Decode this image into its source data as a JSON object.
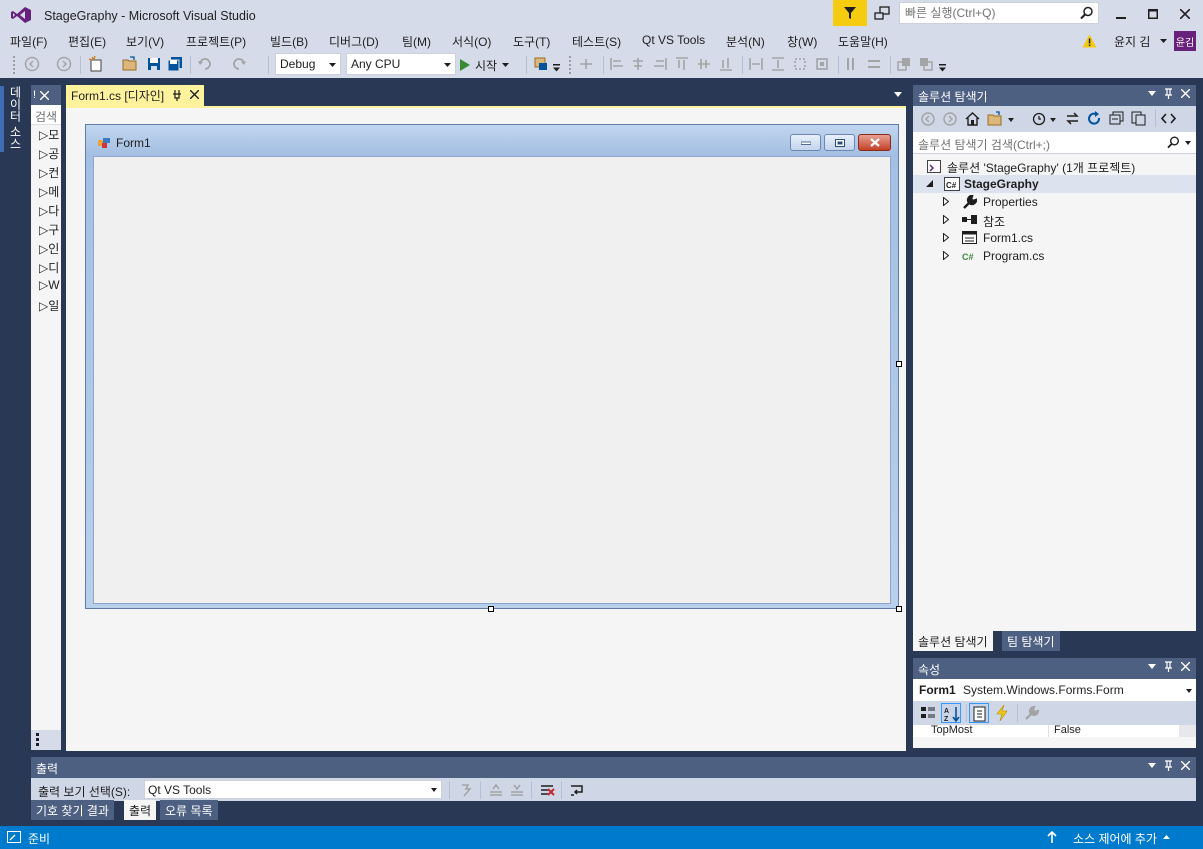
{
  "app": {
    "title": "StageGraphy - Microsoft Visual Studio"
  },
  "quick_launch": {
    "placeholder": "빠른 실행(Ctrl+Q)"
  },
  "menu": [
    "파일(F)",
    "편집(E)",
    "보기(V)",
    "프로젝트(P)",
    "빌드(B)",
    "디버그(D)",
    "팀(M)",
    "서식(O)",
    "도구(T)",
    "테스트(S)",
    "Qt VS Tools",
    "분석(N)",
    "창(W)",
    "도움말(H)"
  ],
  "user": {
    "name": "윤지 김",
    "avatar_text": "윤김"
  },
  "toolbar": {
    "config": "Debug",
    "platform": "Any CPU",
    "start_label": "시작"
  },
  "left_strip": {
    "tab_label": "데이터 소스"
  },
  "toolbox": {
    "header": "!",
    "search": "검색",
    "items": [
      "모",
      "공",
      "컨",
      "메",
      "다",
      "구",
      "인",
      "디",
      "W",
      "일"
    ]
  },
  "document": {
    "tab_label": "Form1.cs [디자인]"
  },
  "form": {
    "title": "Form1"
  },
  "solution_explorer": {
    "title": "솔루션 탐색기",
    "search_placeholder": "솔루션 탐색기 검색(Ctrl+;)",
    "tree": [
      {
        "label": "솔루션 'StageGraphy' (1개 프로젝트)",
        "icon": "solution-icon"
      },
      {
        "label": "StageGraphy",
        "icon": "csharp-project-icon",
        "bold": true,
        "expanded": true
      },
      {
        "label": "Properties",
        "icon": "wrench-icon"
      },
      {
        "label": "참조",
        "icon": "references-icon"
      },
      {
        "label": "Form1.cs",
        "icon": "form-file-icon"
      },
      {
        "label": "Program.cs",
        "icon": "csharp-file-icon"
      }
    ],
    "tabs": [
      "솔루션 탐색기",
      "팀 탐색기"
    ]
  },
  "properties": {
    "title": "속성",
    "object_name": "Form1",
    "object_type": "System.Windows.Forms.Form",
    "row_name": "TopMost",
    "row_value": "False"
  },
  "output": {
    "title": "출력",
    "source_label": "출력 보기 선택(S):",
    "source_value": "Qt VS Tools",
    "tabs": [
      "기호 찾기 결과",
      "출력",
      "오류 목록"
    ]
  },
  "status": {
    "text": "준비",
    "source_control": "소스 제어에 추가"
  },
  "colors": {
    "accent": "#007acc",
    "chrome": "#293955",
    "tab_active": "#fff29d",
    "panel_header": "#4d6082",
    "vs_purple": "#68217a"
  }
}
